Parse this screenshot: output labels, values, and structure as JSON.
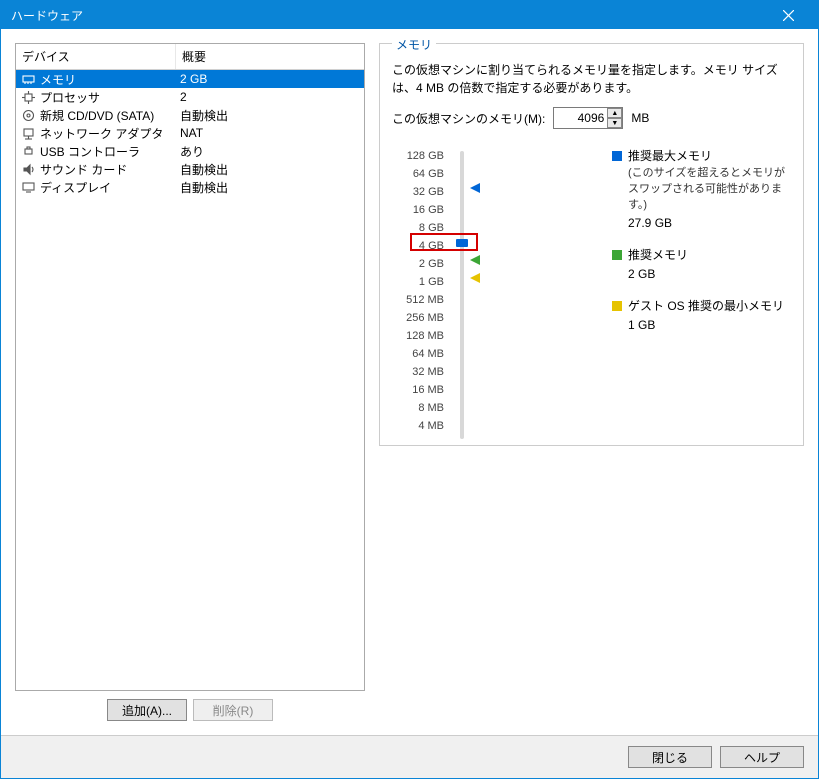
{
  "title": "ハードウェア",
  "columns": {
    "device": "デバイス",
    "summary": "概要"
  },
  "devices": [
    {
      "name": "メモリ",
      "summary": "2 GB",
      "icon": "memory",
      "selected": true
    },
    {
      "name": "プロセッサ",
      "summary": "2",
      "icon": "cpu"
    },
    {
      "name": "新規 CD/DVD (SATA)",
      "summary": "自動検出",
      "icon": "disc"
    },
    {
      "name": "ネットワーク アダプタ",
      "summary": "NAT",
      "icon": "net"
    },
    {
      "name": "USB コントローラ",
      "summary": "あり",
      "icon": "usb"
    },
    {
      "name": "サウンド カード",
      "summary": "自動検出",
      "icon": "sound"
    },
    {
      "name": "ディスプレイ",
      "summary": "自動検出",
      "icon": "display"
    }
  ],
  "buttons": {
    "add": "追加(A)...",
    "remove": "削除(R)",
    "close": "閉じる",
    "help": "ヘルプ"
  },
  "memory": {
    "legend": "メモリ",
    "desc": "この仮想マシンに割り当てられるメモリ量を指定します。メモリ サイズは、4 MB の倍数で指定する必要があります。",
    "label": "この仮想マシンのメモリ(M):",
    "value": "4096",
    "unit": "MB",
    "ticks": [
      "128 GB",
      "64 GB",
      "32 GB",
      "16 GB",
      "8 GB",
      "4 GB",
      "2 GB",
      "1 GB",
      "512 MB",
      "256 MB",
      "128 MB",
      "64 MB",
      "32 MB",
      "16 MB",
      "8 MB",
      "4 MB"
    ],
    "legend_items": {
      "max": {
        "title": "推奨最大メモリ",
        "sub": "(このサイズを超えるとメモリがスワップされる可能性があります。)",
        "value": "27.9 GB"
      },
      "rec": {
        "title": "推奨メモリ",
        "value": "2 GB"
      },
      "min": {
        "title": "ゲスト OS 推奨の最小メモリ",
        "value": "1 GB"
      }
    }
  }
}
